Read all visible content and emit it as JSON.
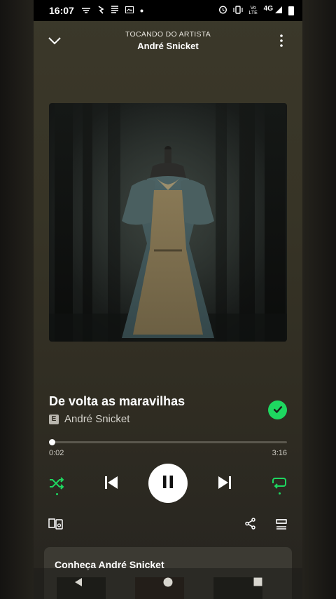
{
  "status_bar": {
    "time": "16:07",
    "network": "4G",
    "volte": "Vo LTE"
  },
  "header": {
    "context_label": "TOCANDO DO ARTISTA",
    "context_title": "André Snicket"
  },
  "track": {
    "title": "De volta as maravilhas",
    "explicit_badge": "E",
    "artist": "André Snicket",
    "liked": true
  },
  "progress": {
    "elapsed": "0:02",
    "total": "3:16",
    "fraction": 0.012
  },
  "colors": {
    "accent": "#1ed760",
    "background": "#3b382a"
  },
  "artist_card": {
    "title": "Conheça André Snicket"
  },
  "icons": {
    "collapse": "chevron-down-icon",
    "more": "more-vertical-icon",
    "shuffle": "shuffle-icon",
    "previous": "skip-previous-icon",
    "pause": "pause-icon",
    "next": "skip-next-icon",
    "repeat": "repeat-icon",
    "devices": "connect-devices-icon",
    "share": "share-icon",
    "queue": "queue-icon"
  }
}
